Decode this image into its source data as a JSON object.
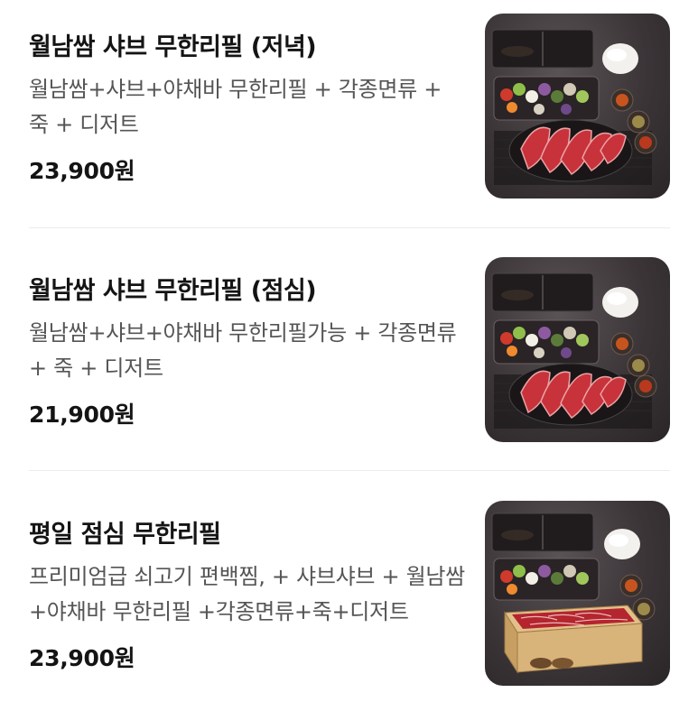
{
  "menu": {
    "items": [
      {
        "title": "월남쌈 샤브 무한리필 (저녁)",
        "description": "월남쌈+샤브+야채바 무한리필 + 각종면류 + 죽 + 디저트",
        "price": "23,900원",
        "image_alt": "shabu-set-photo"
      },
      {
        "title": "월남쌈 샤브 무한리필 (점심)",
        "description": "월남쌈+샤브+야채바 무한리필가능 + 각종면류 + 죽 + 디저트",
        "price": "21,900원",
        "image_alt": "shabu-set-photo"
      },
      {
        "title": "평일 점심 무한리필",
        "description": "프리미엄급 쇠고기 편백찜, + 샤브샤브 + 월남쌈 +야채바 무한리필 +각종면류+죽+디저트",
        "price": "23,900원",
        "image_alt": "shabu-steamed-box-photo"
      }
    ]
  },
  "colors": {
    "title": "#141414",
    "description": "#555555",
    "divider": "#ececec"
  }
}
